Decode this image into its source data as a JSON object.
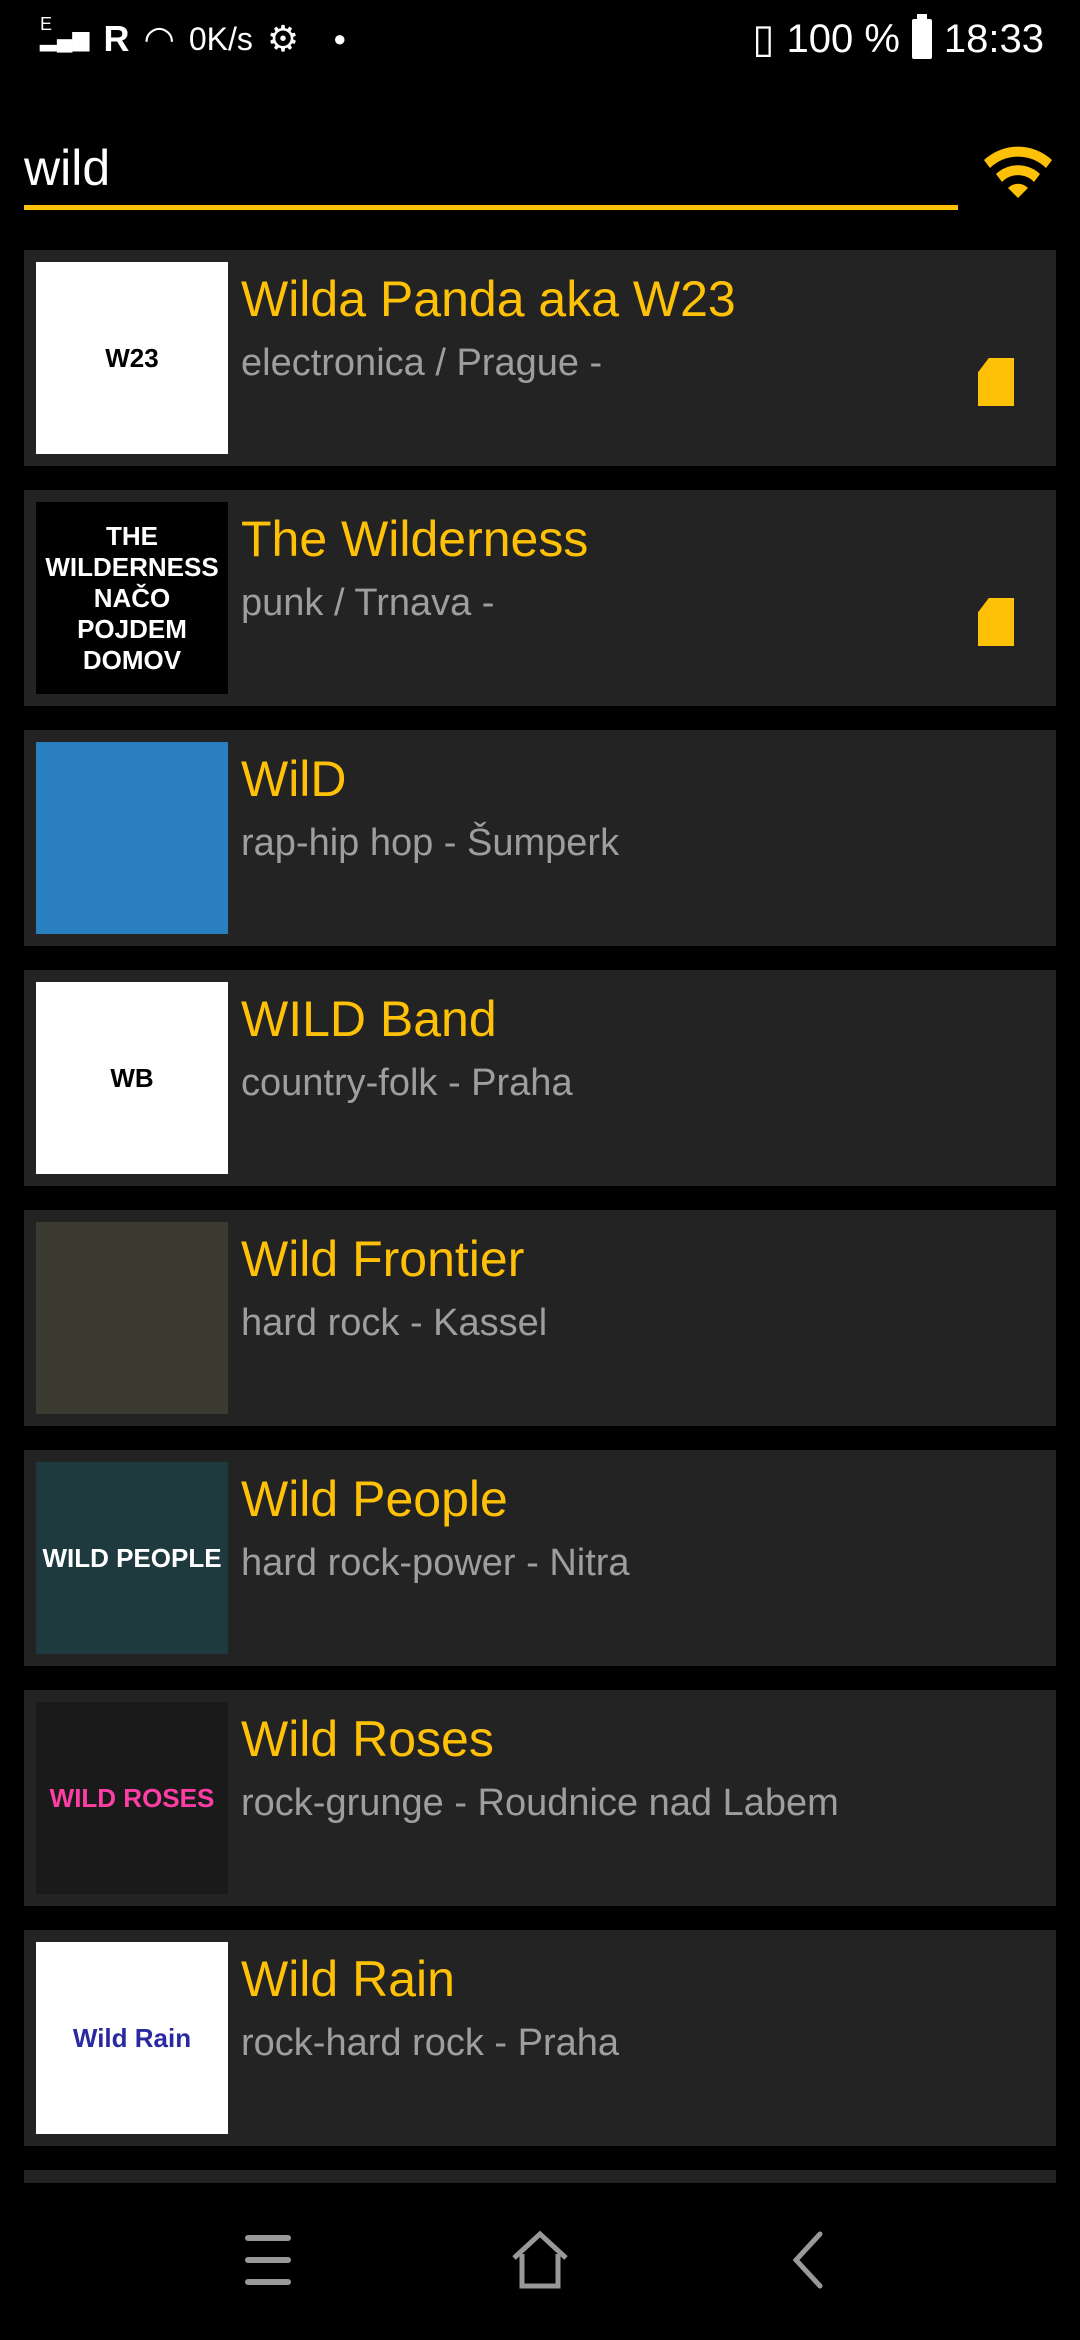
{
  "status_bar": {
    "network": "E",
    "roaming": "R",
    "speed": "0K/s",
    "battery": "100 %",
    "time": "18:33"
  },
  "search": {
    "value": "wild"
  },
  "colors": {
    "accent": "#ffc107",
    "card": "#232323",
    "subtitle": "#9e9e9e"
  },
  "items": [
    {
      "title": "Wilda Panda aka W23",
      "subtitle": "electronica / Prague -",
      "thumb": "W23",
      "sd": true,
      "thumb_bg": "#ffffff",
      "thumb_fg": "#000000"
    },
    {
      "title": "The Wilderness",
      "subtitle": "punk / Trnava -",
      "thumb": "THE WILDERNESS NAČO POJDEM DOMOV",
      "sd": true,
      "thumb_bg": "#000000",
      "thumb_fg": "#ffffff"
    },
    {
      "title": "WilD",
      "subtitle": "rap-hip hop - Šumperk",
      "thumb": "",
      "sd": false,
      "thumb_bg": "#2a7fc0",
      "thumb_fg": "#ffffff"
    },
    {
      "title": "WILD Band",
      "subtitle": "country-folk - Praha",
      "thumb": "WB",
      "sd": false,
      "thumb_bg": "#ffffff",
      "thumb_fg": "#000000"
    },
    {
      "title": "Wild Frontier",
      "subtitle": "hard rock - Kassel",
      "thumb": "",
      "sd": false,
      "thumb_bg": "#3a3a30",
      "thumb_fg": "#ffffff"
    },
    {
      "title": "Wild People",
      "subtitle": "hard rock-power - Nitra",
      "thumb": "WILD PEOPLE",
      "sd": false,
      "thumb_bg": "#1e3a3e",
      "thumb_fg": "#ffffff"
    },
    {
      "title": "Wild Roses",
      "subtitle": "rock-grunge - Roudnice nad Labem",
      "thumb": "WILD ROSES",
      "sd": false,
      "thumb_bg": "#1a1a1a",
      "thumb_fg": "#ff3ea5"
    },
    {
      "title": "Wild Rain",
      "subtitle": "rock-hard rock - Praha",
      "thumb": "Wild Rain",
      "sd": false,
      "thumb_bg": "#ffffff",
      "thumb_fg": "#2a2aa0"
    }
  ]
}
